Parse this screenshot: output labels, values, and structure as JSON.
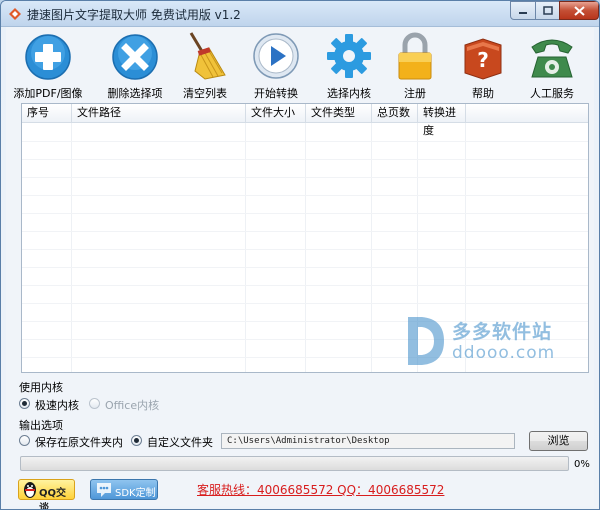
{
  "window": {
    "title": "捷速图片文字提取大师 免费试用版 v1.2"
  },
  "toolbar": {
    "items": [
      {
        "label": "添加PDF/图像",
        "icon": "add-icon"
      },
      {
        "label": "删除选择项",
        "icon": "delete-icon"
      },
      {
        "label": "清空列表",
        "icon": "broom-icon"
      },
      {
        "label": "开始转换",
        "icon": "play-icon"
      },
      {
        "label": "选择内核",
        "icon": "gear-icon"
      },
      {
        "label": "注册",
        "icon": "lock-icon"
      },
      {
        "label": "帮助",
        "icon": "help-book-icon"
      },
      {
        "label": "人工服务",
        "icon": "phone-icon"
      }
    ]
  },
  "table": {
    "columns": [
      "序号",
      "文件路径",
      "文件大小",
      "文件类型",
      "总页数",
      "转换进度"
    ],
    "rows": []
  },
  "engine": {
    "heading": "使用内核",
    "options": [
      {
        "label": "极速内核",
        "selected": true,
        "disabled": false
      },
      {
        "label": "Office内核",
        "selected": false,
        "disabled": true
      }
    ]
  },
  "output": {
    "heading": "输出选项",
    "options": [
      {
        "label": "保存在原文件夹内",
        "selected": false
      },
      {
        "label": "自定义文件夹",
        "selected": true
      }
    ],
    "path": "C:\\Users\\Administrator\\Desktop",
    "browse_label": "浏览"
  },
  "progress": {
    "value": 0,
    "label": "0%"
  },
  "footer": {
    "qq_label": "QQ交谈",
    "sdk_label": "SDK定制",
    "hotline": "客服热线：4006685572 QQ：4006685572"
  },
  "watermark": {
    "line1": "多多软件站",
    "line2": "ddooo.com"
  },
  "colors": {
    "accent": "#2b8ed6",
    "hotline": "#d81e1e"
  }
}
